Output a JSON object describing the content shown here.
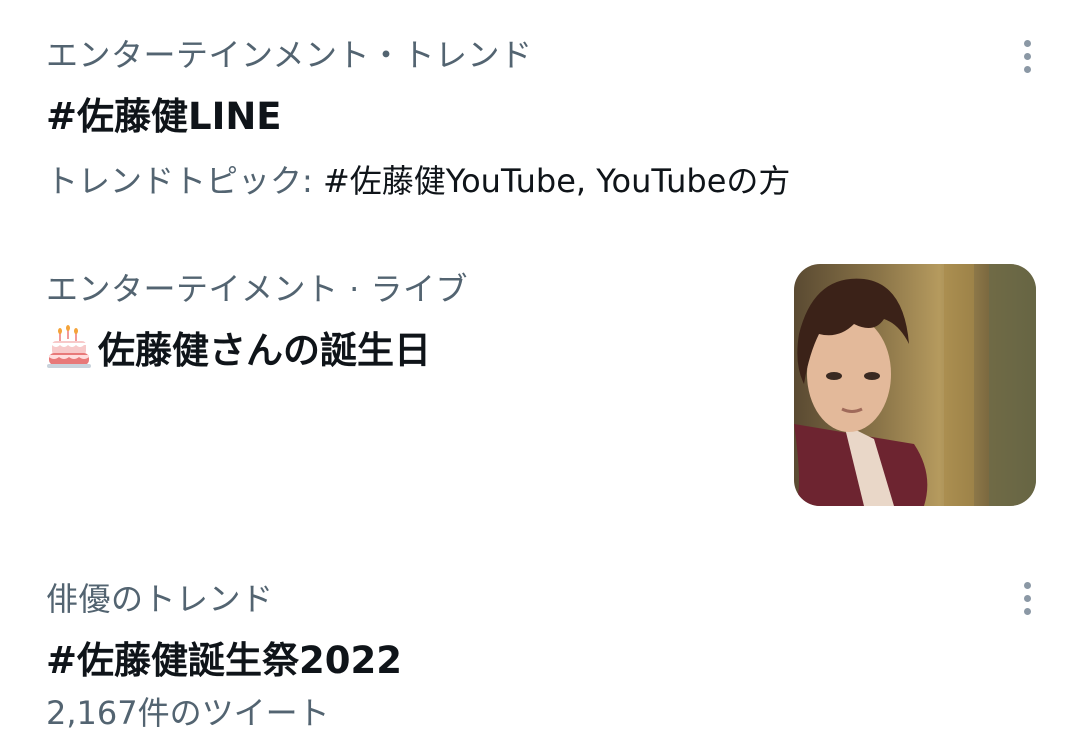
{
  "trends": [
    {
      "category": "エンターテインメント・トレンド",
      "title": "#佐藤健LINE",
      "topics_label": "トレンドトピック:",
      "topics_value": "#佐藤健YouTube, YouTubeの方"
    },
    {
      "category": "エンターテイメント · ライブ",
      "icon": "birthday-cake-icon",
      "title": "佐藤健さんの誕生日"
    },
    {
      "category": "俳優のトレンド",
      "title": "#佐藤健誕生祭2022",
      "tweet_count": "2,167件のツイート"
    }
  ],
  "colors": {
    "secondary_text": "#536471",
    "primary_text": "#0f1419",
    "more_dots": "#8b98a5"
  }
}
